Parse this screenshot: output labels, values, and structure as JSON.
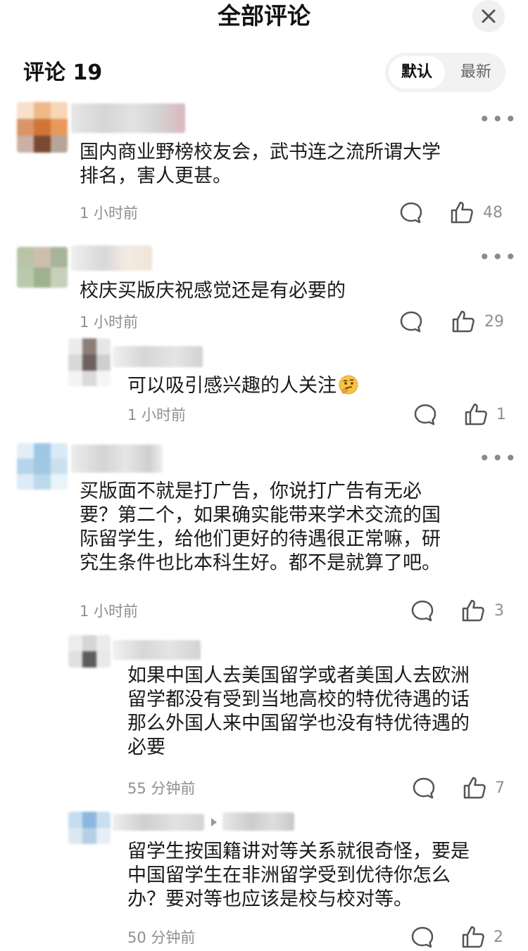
{
  "header": {
    "title": "全部评论"
  },
  "subheader": {
    "count_label": "评论 19",
    "sort_active": "默认",
    "sort_inactive": "最新"
  },
  "comments": [
    {
      "text_lines": [
        "国内商业野榜校友会，武书连之流所谓大学",
        "排名，害人更甚。"
      ],
      "time": "1 小时前",
      "likes": "48"
    },
    {
      "text_lines": [
        "校庆买版庆祝感觉还是有必要的"
      ],
      "time": "1 小时前",
      "likes": "29"
    },
    {
      "text_lines": [
        "可以吸引感兴趣的人关注"
      ],
      "time": "1 小时前",
      "likes": "1"
    },
    {
      "text_lines": [
        "买版面不就是打广告，你说打广告有无必",
        "要？第二个，如果确实能带来学术交流的国",
        "际留学生，给他们更好的待遇很正常嘛，研",
        "究生条件也比本科生好。都不是就算了吧。"
      ],
      "time": "1 小时前",
      "likes": "3"
    },
    {
      "text_lines": [
        "如果中国人去美国留学或者美国人去欧洲",
        "留学都没有受到当地高校的特优待遇的话",
        "那么外国人来中国留学也没有特优待遇的",
        "必要"
      ],
      "time": "55 分钟前",
      "likes": "7"
    },
    {
      "text_lines": [
        "留学生按国籍讲对等关系就很奇怪，要是",
        "中国留学生在非洲留学受到优待你怎么",
        "办？要对等也应该是校与校对等。"
      ],
      "time": "50 分钟前",
      "likes": "2"
    }
  ],
  "icons": {
    "close": "close-icon",
    "more": "more-icon",
    "reply": "comment-bubble-icon",
    "like": "thumbs-up-icon",
    "emoji": "thinking-face-emoji",
    "reply_arrow": "reply-arrow-icon"
  },
  "colors": {
    "text": "#1a1a1a",
    "meta": "#8f8f8f",
    "sort_bg": "#f2f2f2"
  }
}
